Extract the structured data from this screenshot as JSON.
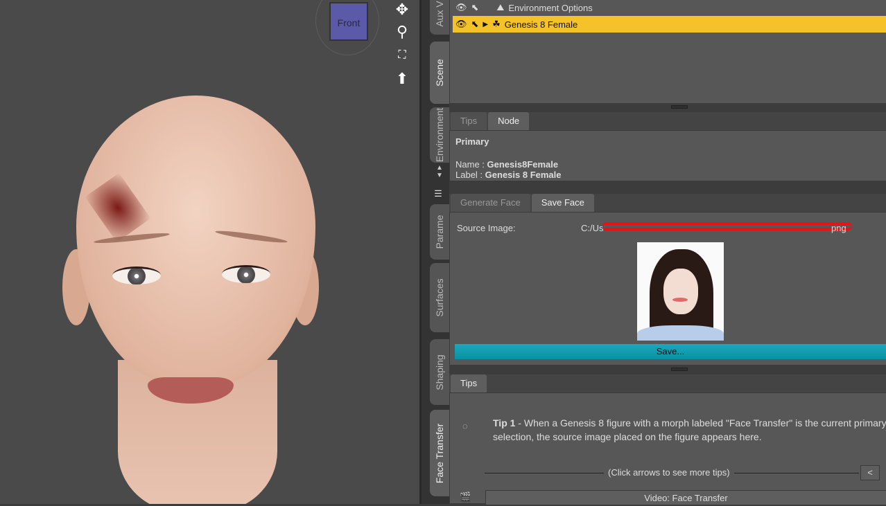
{
  "viewport": {
    "cube_label": "Front"
  },
  "scene": {
    "items": [
      {
        "label": "Environment Options"
      },
      {
        "label": "Genesis 8 Female",
        "selected": true
      }
    ]
  },
  "side_tabs": [
    "Aux V",
    "Scene",
    "Environment",
    "Parame",
    "Surfaces",
    "Shaping",
    "Face Transfer"
  ],
  "node_panel": {
    "tabs": [
      "Tips",
      "Node"
    ],
    "active": "Node",
    "heading": "Primary",
    "name_key": "Name : ",
    "name_val": "Genesis8Female",
    "label_key": "Label : ",
    "label_val": "Genesis 8 Female"
  },
  "face_panel": {
    "tabs": [
      "Generate Face",
      "Save Face"
    ],
    "active": "Save Face",
    "source_label": "Source Image:",
    "source_path": "C:/Us",
    "source_path_end": "png",
    "save_label": "Save..."
  },
  "tips_panel": {
    "tab": "Tips",
    "tip_title": "Tip 1",
    "tip_text": " - When a Genesis 8 figure with a morph labeled \"Face Transfer\" is the current primary selection, the source image placed on the figure appears here.",
    "hint": "(Click arrows to see more tips)",
    "prev": "<",
    "video": "Video: Face Transfer"
  },
  "colors": {
    "selection": "#f5c22a",
    "save_button": "#1aa9bd"
  }
}
